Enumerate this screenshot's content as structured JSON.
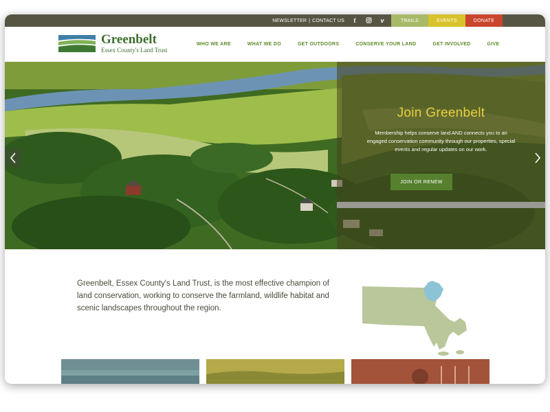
{
  "utility": {
    "newsletter": "NEWSLETTER",
    "separator": "|",
    "contact": "CONTACT US",
    "social_icons": [
      "facebook-icon",
      "instagram-icon",
      "vimeo-icon"
    ],
    "trails": "TRAILS",
    "events": "EVENTS",
    "donate": "DONATE"
  },
  "brand": {
    "title": "Greenbelt",
    "subtitle": "Essex County's Land Trust"
  },
  "nav": {
    "items": [
      "WHO WE ARE",
      "WHAT WE DO",
      "GET OUTDOORS",
      "CONSERVE YOUR LAND",
      "GET INVOLVED",
      "GIVE"
    ]
  },
  "hero": {
    "title": "Join Greenbelt",
    "text": "Membership helps conserve land AND connects you to an engaged conservation community through our properties, special events and regular updates on our work.",
    "button": "JOIN OR RENEW",
    "prev_icon": "chevron-left-icon",
    "next_icon": "chevron-right-icon"
  },
  "intro": {
    "text": "Greenbelt, Essex County's Land Trust, is the most effective champion of land conservation, working to conserve the farmland, wildlife habitat and scenic landscapes throughout the region."
  },
  "colors": {
    "utility_bar": "#565544",
    "trails": "#a8b968",
    "events": "#d9c32a",
    "donate": "#c9452d",
    "brand_green": "#3e6e2e",
    "nav_green": "#5c8a26",
    "hero_title": "#e6cf3c",
    "button_green": "#56802e"
  }
}
